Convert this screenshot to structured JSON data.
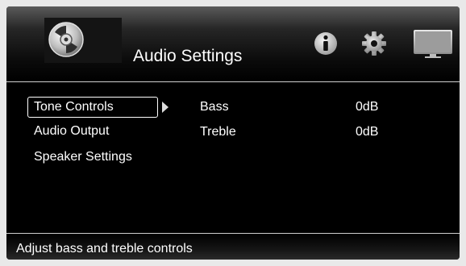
{
  "header": {
    "title": "Audio Settings",
    "icons": [
      "disc-icon",
      "info-icon",
      "gear-icon",
      "monitor-icon"
    ]
  },
  "menu": {
    "items": [
      {
        "label": "Tone Controls"
      },
      {
        "label": "Audio Output"
      },
      {
        "label": "Speaker Settings"
      }
    ]
  },
  "settings": [
    {
      "name": "Bass",
      "value": "0dB"
    },
    {
      "name": "Treble",
      "value": "0dB"
    }
  ],
  "footer": {
    "hint": "Adjust bass and treble controls"
  },
  "colors": {
    "background": "#000000",
    "text": "#ffffff",
    "divider": "#d0d0d0"
  }
}
